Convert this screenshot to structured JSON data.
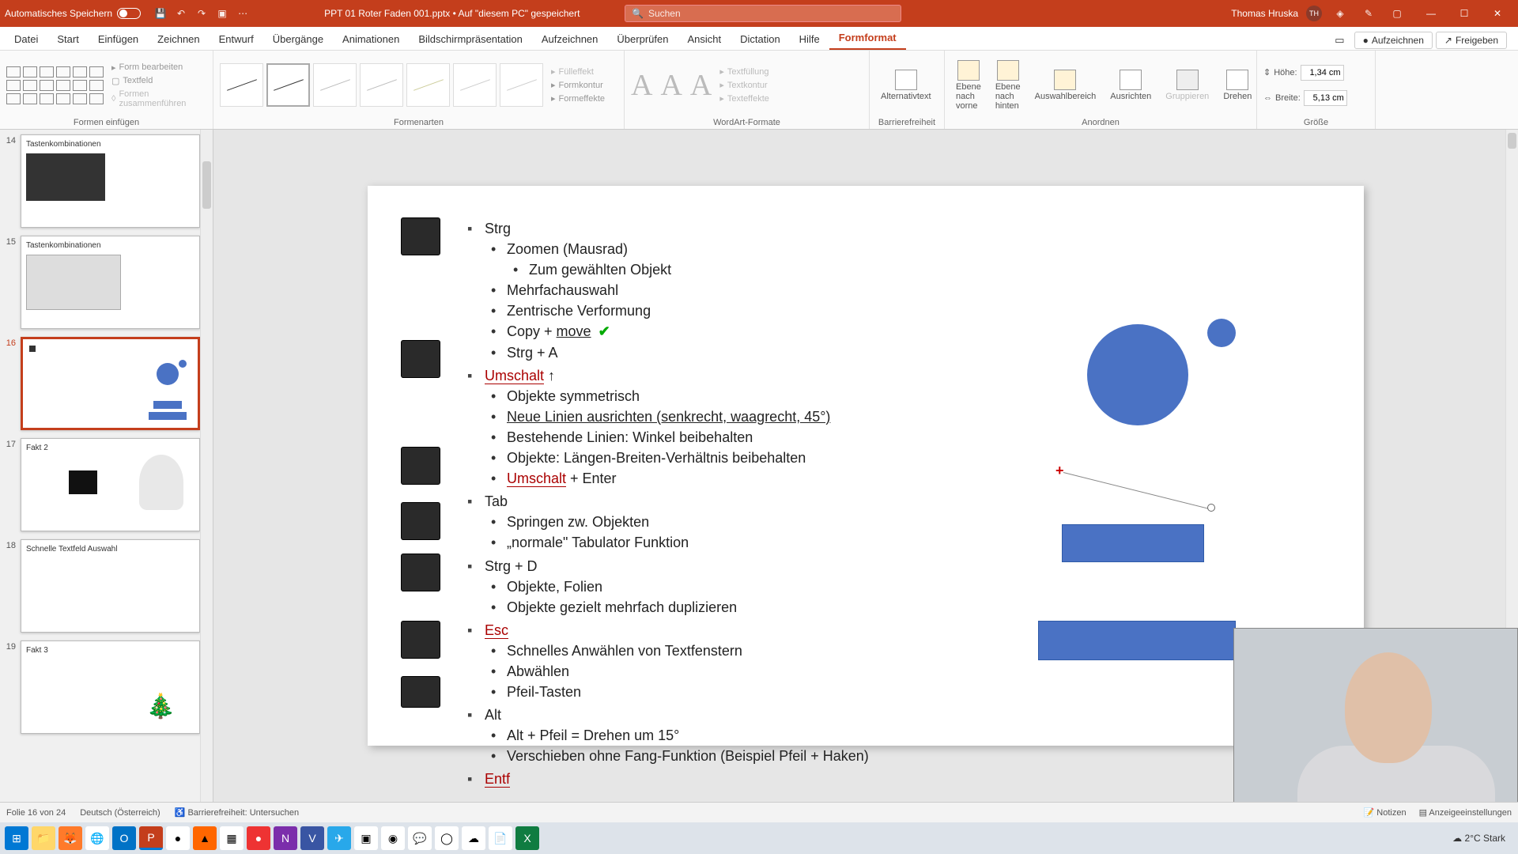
{
  "titlebar": {
    "autosave_label": "Automatisches Speichern",
    "document_title": "PPT 01 Roter Faden 001.pptx • Auf \"diesem PC\" gespeichert",
    "search_placeholder": "Suchen",
    "user_name": "Thomas Hruska",
    "user_initials": "TH"
  },
  "tabs": {
    "items": [
      "Datei",
      "Start",
      "Einfügen",
      "Zeichnen",
      "Entwurf",
      "Übergänge",
      "Animationen",
      "Bildschirmpräsentation",
      "Aufzeichnen",
      "Überprüfen",
      "Ansicht",
      "Dictation",
      "Hilfe",
      "Formformat"
    ],
    "active": "Formformat",
    "record_btn": "Aufzeichnen",
    "share_btn": "Freigeben"
  },
  "ribbon": {
    "insert_shapes": {
      "label": "Formen einfügen",
      "edit_shape": "Form bearbeiten",
      "textbox": "Textfeld",
      "merge": "Formen zusammenführen"
    },
    "shape_styles": {
      "label": "Formenarten",
      "fill": "Fülleffekt",
      "outline": "Formkontur",
      "effects": "Formeffekte"
    },
    "wordart": {
      "label": "WordArt-Formate",
      "textfill": "Textfüllung",
      "textoutline": "Textkontur",
      "texteffects": "Texteffekte"
    },
    "accessibility": {
      "label": "Barrierefreiheit",
      "alttext": "Alternativtext"
    },
    "arrange": {
      "label": "Anordnen",
      "bring_fwd": "Ebene nach vorne",
      "send_back": "Ebene nach hinten",
      "selection": "Auswahlbereich",
      "align": "Ausrichten",
      "group": "Gruppieren",
      "rotate": "Drehen"
    },
    "size": {
      "label": "Größe",
      "height_lbl": "Höhe:",
      "width_lbl": "Breite:",
      "height_val": "1,34 cm",
      "width_val": "5,13 cm"
    }
  },
  "thumbnails": [
    {
      "num": "14",
      "title": "Tastenkombinationen"
    },
    {
      "num": "15",
      "title": "Tastenkombinationen"
    },
    {
      "num": "16",
      "title": ""
    },
    {
      "num": "17",
      "title": "Fakt 2"
    },
    {
      "num": "18",
      "title": "Schnelle Textfeld Auswahl"
    },
    {
      "num": "19",
      "title": "Fakt 3"
    }
  ],
  "slide": {
    "strg": "Strg",
    "strg_items": [
      "Zoomen (Mausrad)",
      "Zum gewählten Objekt",
      "Mehrfachauswahl",
      "Zentrische Verformung",
      "Copy + move",
      "Strg + A"
    ],
    "umschalt": "Umschalt",
    "umschalt_items": [
      "Objekte symmetrisch",
      "Neue Linien ausrichten (senkrecht, waagrecht, 45°)",
      "Bestehende Linien: Winkel beibehalten",
      "Objekte: Längen-Breiten-Verhältnis beibehalten",
      "Umschalt + Enter"
    ],
    "tab": "Tab",
    "tab_items": [
      "Springen zw. Objekten",
      "„normale\" Tabulator Funktion"
    ],
    "strgd": "Strg + D",
    "strgd_items": [
      "Objekte, Folien",
      "Objekte gezielt mehrfach duplizieren"
    ],
    "esc": "Esc",
    "esc_items": [
      "Schnelles Anwählen von Textfenstern",
      "Abwählen",
      "Pfeil-Tasten"
    ],
    "alt": "Alt",
    "alt_items": [
      "Alt + Pfeil = Drehen um 15°",
      "Verschieben ohne Fang-Funktion (Beispiel Pfeil + Haken)"
    ],
    "entf": "Entf"
  },
  "statusbar": {
    "slide_of": "Folie 16 von 24",
    "language": "Deutsch (Österreich)",
    "accessibility": "Barrierefreiheit: Untersuchen",
    "notes": "Notizen",
    "display": "Anzeigeeinstellungen"
  },
  "taskbar": {
    "weather": "2°C  Stark"
  }
}
